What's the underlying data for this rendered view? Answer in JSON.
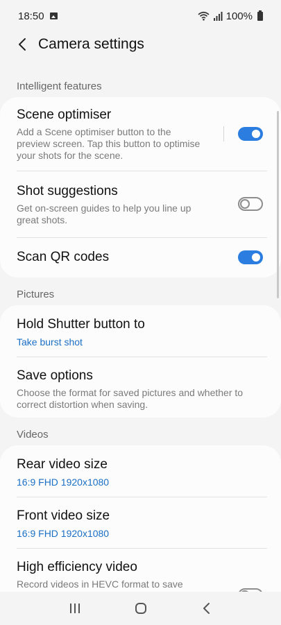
{
  "status_bar": {
    "time": "18:50",
    "battery": "100%"
  },
  "header": {
    "title": "Camera settings"
  },
  "sections": {
    "intelligent": {
      "header": "Intelligent features",
      "scene_optimiser": {
        "title": "Scene optimiser",
        "desc": "Add a Scene optimiser button to the preview screen. Tap this button to optimise your shots for the scene.",
        "toggle": "on"
      },
      "shot_suggestions": {
        "title": "Shot suggestions",
        "desc": "Get on-screen guides to help you line up great shots.",
        "toggle": "off"
      },
      "scan_qr": {
        "title": "Scan QR codes",
        "toggle": "on"
      }
    },
    "pictures": {
      "header": "Pictures",
      "hold_shutter": {
        "title": "Hold Shutter button to",
        "value": "Take burst shot"
      },
      "save_options": {
        "title": "Save options",
        "desc": "Choose the format for saved pictures and whether to correct distortion when saving."
      }
    },
    "videos": {
      "header": "Videos",
      "rear_video": {
        "title": "Rear video size",
        "value": "16:9 FHD 1920x1080"
      },
      "front_video": {
        "title": "Front video size",
        "value": "16:9 FHD 1920x1080"
      },
      "high_efficiency": {
        "title": "High efficiency video",
        "desc": "Record videos in HEVC format to save space. You may not be able to play HEVC videos on other devices or share them online.",
        "toggle": "off"
      }
    }
  },
  "colors": {
    "accent": "#2b7de0",
    "value_text": "#1a6fc4",
    "background": "#f4f4f4",
    "card": "#fcfcfc"
  },
  "icons": {
    "back": "chevron-left-icon",
    "gallery": "image-icon",
    "wifi": "wifi-icon",
    "signal": "signal-icon",
    "battery": "battery-icon",
    "recents": "recents-icon",
    "home": "home-icon",
    "nav_back": "back-icon"
  }
}
